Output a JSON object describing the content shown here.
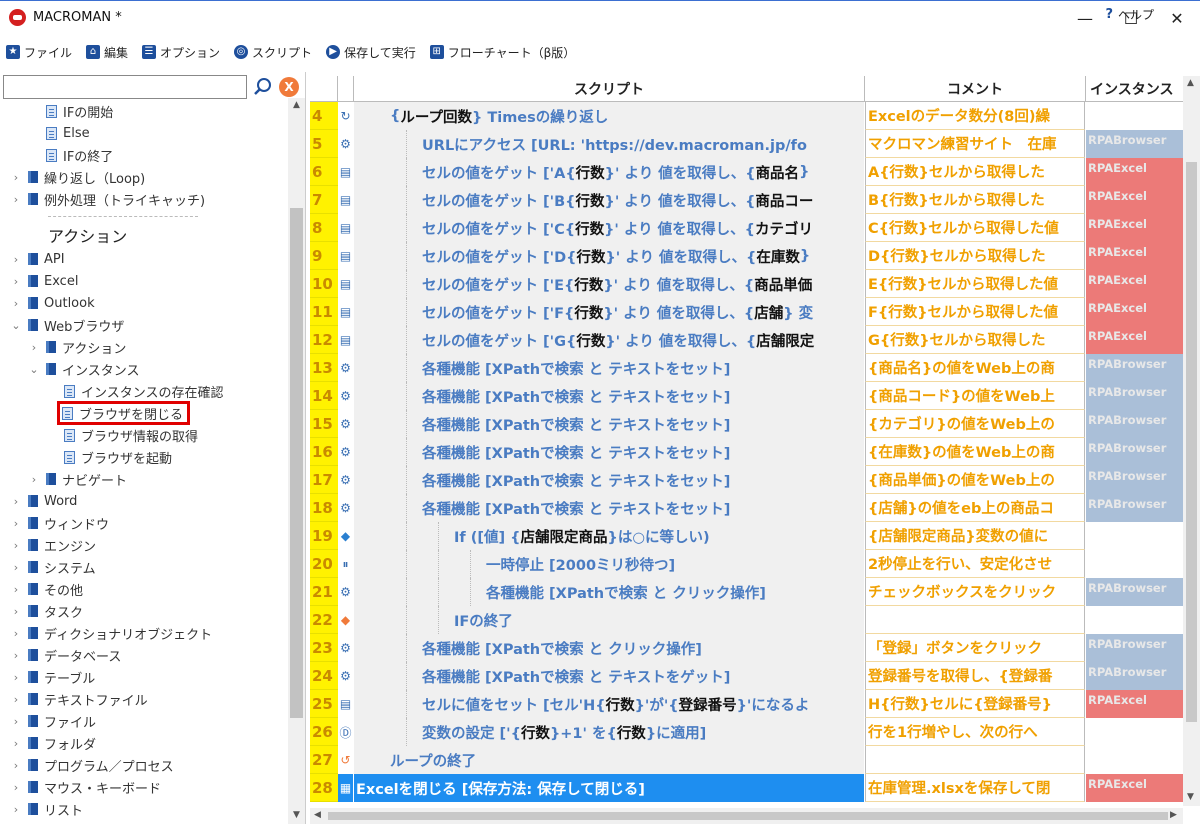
{
  "window": {
    "title": "MACROMAN *",
    "minimize": "—",
    "maximize": "☐",
    "close": "✕"
  },
  "menu": {
    "items": [
      {
        "label": "ファイル",
        "icon": "star-icon"
      },
      {
        "label": "編集",
        "icon": "home-icon"
      },
      {
        "label": "オプション",
        "icon": "list-icon"
      },
      {
        "label": "スクリプト",
        "icon": "target-icon"
      },
      {
        "label": "保存して実行",
        "icon": "play-icon"
      },
      {
        "label": "フローチャート（β版）",
        "icon": "flowchart-icon"
      }
    ],
    "help": "ヘルプ"
  },
  "search": {
    "value": "",
    "clear": "X"
  },
  "tree": {
    "items": [
      {
        "label": "IFの開始",
        "type": "doc",
        "indent": 2
      },
      {
        "label": "Else",
        "type": "doc",
        "indent": 2
      },
      {
        "label": "IFの終了",
        "type": "doc",
        "indent": 2
      },
      {
        "label": "繰り返し（Loop)",
        "type": "book",
        "indent": 0,
        "chev": "›"
      },
      {
        "label": "例外処理（トライキャッチ)",
        "type": "book",
        "indent": 0,
        "chev": "›"
      },
      {
        "label": "アクション",
        "type": "section"
      },
      {
        "label": "API",
        "type": "book",
        "indent": 0,
        "chev": "›"
      },
      {
        "label": "Excel",
        "type": "book",
        "indent": 0,
        "chev": "›"
      },
      {
        "label": "Outlook",
        "type": "book",
        "indent": 0,
        "chev": "›"
      },
      {
        "label": "Webブラウザ",
        "type": "book",
        "indent": 0,
        "chev": "⌄"
      },
      {
        "label": "アクション",
        "type": "book",
        "indent": 1,
        "chev": "›"
      },
      {
        "label": "インスタンス",
        "type": "book",
        "indent": 1,
        "chev": "⌄"
      },
      {
        "label": "インスタンスの存在確認",
        "type": "doc",
        "indent": 3
      },
      {
        "label": "ブラウザを閉じる",
        "type": "doc",
        "indent": 3,
        "highlight": true
      },
      {
        "label": "ブラウザ情報の取得",
        "type": "doc",
        "indent": 3
      },
      {
        "label": "ブラウザを起動",
        "type": "doc",
        "indent": 3
      },
      {
        "label": "ナビゲート",
        "type": "book",
        "indent": 1,
        "chev": "›"
      },
      {
        "label": "Word",
        "type": "book",
        "indent": 0,
        "chev": "›"
      },
      {
        "label": "ウィンドウ",
        "type": "book",
        "indent": 0,
        "chev": "›"
      },
      {
        "label": "エンジン",
        "type": "book",
        "indent": 0,
        "chev": "›"
      },
      {
        "label": "システム",
        "type": "book",
        "indent": 0,
        "chev": "›"
      },
      {
        "label": "その他",
        "type": "book",
        "indent": 0,
        "chev": "›"
      },
      {
        "label": "タスク",
        "type": "book",
        "indent": 0,
        "chev": "›"
      },
      {
        "label": "ディクショナリオブジェクト",
        "type": "book",
        "indent": 0,
        "chev": "›"
      },
      {
        "label": "データベース",
        "type": "book",
        "indent": 0,
        "chev": "›"
      },
      {
        "label": "テーブル",
        "type": "book",
        "indent": 0,
        "chev": "›"
      },
      {
        "label": "テキストファイル",
        "type": "book",
        "indent": 0,
        "chev": "›"
      },
      {
        "label": "ファイル",
        "type": "book",
        "indent": 0,
        "chev": "›"
      },
      {
        "label": "フォルダ",
        "type": "book",
        "indent": 0,
        "chev": "›"
      },
      {
        "label": "プログラム／プロセス",
        "type": "book",
        "indent": 0,
        "chev": "›"
      },
      {
        "label": "マウス・キーボード",
        "type": "book",
        "indent": 0,
        "chev": "›"
      },
      {
        "label": "リスト",
        "type": "book",
        "indent": 0,
        "chev": "›"
      }
    ]
  },
  "grid": {
    "headers": {
      "script": "スクリプト",
      "comment": "コメント",
      "instance": "インスタンス"
    },
    "rows": [
      {
        "num": "4",
        "icon": "loop-icon",
        "glyph": "↻",
        "level": 1,
        "parts": [
          [
            "{"
          ],
          [
            "ループ回数",
            1
          ],
          [
            "} Timesの繰り返し"
          ]
        ],
        "comment": "Excelのデータ数分(8回)繰",
        "instance": "",
        "itype": ""
      },
      {
        "num": "5",
        "icon": "browser-icon",
        "glyph": "⚙",
        "level": 2,
        "parts": [
          [
            "URLにアクセス [URL: 'https://dev.macroman.jp/fo"
          ]
        ],
        "comment": "マクロマン練習サイト　在庫",
        "instance": "RPABrowser",
        "itype": "browser"
      },
      {
        "num": "6",
        "icon": "excel-cell-icon",
        "glyph": "▤",
        "level": 2,
        "parts": [
          [
            "セルの値をゲット ['A{"
          ],
          [
            "行数",
            1
          ],
          [
            "}' より 値を取得し、{"
          ],
          [
            "商品名",
            1
          ],
          [
            "}"
          ]
        ],
        "comment": "A{行数}セルから取得した",
        "instance": "RPAExcel",
        "itype": "excel"
      },
      {
        "num": "7",
        "icon": "excel-cell-icon",
        "glyph": "▤",
        "level": 2,
        "parts": [
          [
            "セルの値をゲット ['B{"
          ],
          [
            "行数",
            1
          ],
          [
            "}' より 値を取得し、{"
          ],
          [
            "商品コー",
            1
          ]
        ],
        "comment": "B{行数}セルから取得した",
        "instance": "RPAExcel",
        "itype": "excel"
      },
      {
        "num": "8",
        "icon": "excel-cell-icon",
        "glyph": "▤",
        "level": 2,
        "parts": [
          [
            "セルの値をゲット ['C{"
          ],
          [
            "行数",
            1
          ],
          [
            "}' より 値を取得し、{"
          ],
          [
            "カテゴリ",
            1
          ]
        ],
        "comment": "C{行数}セルから取得した値",
        "instance": "RPAExcel",
        "itype": "excel"
      },
      {
        "num": "9",
        "icon": "excel-cell-icon",
        "glyph": "▤",
        "level": 2,
        "parts": [
          [
            "セルの値をゲット ['D{"
          ],
          [
            "行数",
            1
          ],
          [
            "}' より 値を取得し、{"
          ],
          [
            "在庫数",
            1
          ],
          [
            "} "
          ]
        ],
        "comment": "D{行数}セルから取得した",
        "instance": "RPAExcel",
        "itype": "excel"
      },
      {
        "num": "10",
        "icon": "excel-cell-icon",
        "glyph": "▤",
        "level": 2,
        "parts": [
          [
            "セルの値をゲット ['E{"
          ],
          [
            "行数",
            1
          ],
          [
            "}' より 値を取得し、{"
          ],
          [
            "商品単価",
            1
          ]
        ],
        "comment": "E{行数}セルから取得した値",
        "instance": "RPAExcel",
        "itype": "excel"
      },
      {
        "num": "11",
        "icon": "excel-cell-icon",
        "glyph": "▤",
        "level": 2,
        "parts": [
          [
            "セルの値をゲット ['F{"
          ],
          [
            "行数",
            1
          ],
          [
            "}' より 値を取得し、{"
          ],
          [
            "店舗",
            1
          ],
          [
            "} 変"
          ]
        ],
        "comment": "F{行数}セルから取得した値",
        "instance": "RPAExcel",
        "itype": "excel"
      },
      {
        "num": "12",
        "icon": "excel-cell-icon",
        "glyph": "▤",
        "level": 2,
        "parts": [
          [
            "セルの値をゲット ['G{"
          ],
          [
            "行数",
            1
          ],
          [
            "}' より 値を取得し、{"
          ],
          [
            "店舗限定",
            1
          ]
        ],
        "comment": "G{行数}セルから取得した",
        "instance": "RPAExcel",
        "itype": "excel"
      },
      {
        "num": "13",
        "icon": "browser-icon",
        "glyph": "⚙",
        "level": 2,
        "parts": [
          [
            "各種機能 [XPathで検索 と テキストをセット]"
          ]
        ],
        "comment": "{商品名}の値をWeb上の商",
        "instance": "RPABrowser",
        "itype": "browser"
      },
      {
        "num": "14",
        "icon": "browser-icon",
        "glyph": "⚙",
        "level": 2,
        "parts": [
          [
            "各種機能 [XPathで検索 と テキストをセット]"
          ]
        ],
        "comment": "{商品コード}の値をWeb上",
        "instance": "RPABrowser",
        "itype": "browser"
      },
      {
        "num": "15",
        "icon": "browser-icon",
        "glyph": "⚙",
        "level": 2,
        "parts": [
          [
            "各種機能 [XPathで検索 と テキストをセット]"
          ]
        ],
        "comment": "{カテゴリ}の値をWeb上の",
        "instance": "RPABrowser",
        "itype": "browser"
      },
      {
        "num": "16",
        "icon": "browser-icon",
        "glyph": "⚙",
        "level": 2,
        "parts": [
          [
            "各種機能 [XPathで検索 と テキストをセット]"
          ]
        ],
        "comment": "{在庫数}の値をWeb上の商",
        "instance": "RPABrowser",
        "itype": "browser"
      },
      {
        "num": "17",
        "icon": "browser-icon",
        "glyph": "⚙",
        "level": 2,
        "parts": [
          [
            "各種機能 [XPathで検索 と テキストをセット]"
          ]
        ],
        "comment": "{商品単価}の値をWeb上の",
        "instance": "RPABrowser",
        "itype": "browser"
      },
      {
        "num": "18",
        "icon": "browser-icon",
        "glyph": "⚙",
        "level": 2,
        "parts": [
          [
            "各種機能 [XPathで検索 と テキストをセット]"
          ]
        ],
        "comment": "{店舗}の値をeb上の商品コ",
        "instance": "RPABrowser",
        "itype": "browser"
      },
      {
        "num": "19",
        "icon": "if-diamond-icon",
        "glyph": "◆",
        "level": 3,
        "parts": [
          [
            "If ([値] {"
          ],
          [
            "店舗限定商品",
            1
          ],
          [
            "}は○に等しい)"
          ]
        ],
        "comment": "{店舗限定商品}変数の値に",
        "instance": "",
        "itype": ""
      },
      {
        "num": "20",
        "icon": "pause-icon",
        "glyph": "⏸",
        "level": 4,
        "parts": [
          [
            "一時停止 [2000ミリ秒待つ]"
          ]
        ],
        "comment": "2秒停止を行い、安定化させ",
        "instance": "",
        "itype": ""
      },
      {
        "num": "21",
        "icon": "browser-icon",
        "glyph": "⚙",
        "level": 4,
        "parts": [
          [
            "各種機能 [XPathで検索 と クリック操作]"
          ]
        ],
        "comment": "チェックボックスをクリック",
        "instance": "RPABrowser",
        "itype": "browser"
      },
      {
        "num": "22",
        "icon": "endif-diamond-icon",
        "glyph": "◆",
        "level": 3,
        "parts": [
          [
            "IFの終了"
          ]
        ],
        "comment": "",
        "instance": "",
        "itype": ""
      },
      {
        "num": "23",
        "icon": "browser-icon",
        "glyph": "⚙",
        "level": 2,
        "parts": [
          [
            "各種機能 [XPathで検索 と クリック操作]"
          ]
        ],
        "comment": "「登録」ボタンをクリック",
        "instance": "RPABrowser",
        "itype": "browser"
      },
      {
        "num": "24",
        "icon": "browser-icon",
        "glyph": "⚙",
        "level": 2,
        "parts": [
          [
            "各種機能 [XPathで検索 と テキストをゲット]"
          ]
        ],
        "comment": "登録番号を取得し、{登録番",
        "instance": "RPABrowser",
        "itype": "browser"
      },
      {
        "num": "25",
        "icon": "excel-cell-icon",
        "glyph": "▤",
        "level": 2,
        "parts": [
          [
            "セルに値をセット [セル'H{"
          ],
          [
            "行数",
            1
          ],
          [
            "}'が'{"
          ],
          [
            "登録番号",
            1
          ],
          [
            "}'になるよ"
          ]
        ],
        "comment": "H{行数}セルに{登録番号}",
        "instance": "RPAExcel",
        "itype": "excel"
      },
      {
        "num": "26",
        "icon": "variable-icon",
        "glyph": "Ⓓ",
        "level": 2,
        "parts": [
          [
            "変数の設定 ['{"
          ],
          [
            "行数",
            1
          ],
          [
            "}+1' を{"
          ],
          [
            "行数",
            1
          ],
          [
            "}に適用]"
          ]
        ],
        "comment": "行を1行増やし、次の行へ",
        "instance": "",
        "itype": ""
      },
      {
        "num": "27",
        "icon": "loop-end-icon",
        "glyph": "↺",
        "level": 1,
        "parts": [
          [
            "ループの終了"
          ]
        ],
        "comment": "",
        "instance": "",
        "itype": ""
      },
      {
        "num": "28",
        "icon": "excel-close-icon",
        "glyph": "▦",
        "level": 0,
        "parts": [
          [
            "Excelを閉じる [保存方法: 保存して閉じる]"
          ]
        ],
        "comment": "在庫管理.xlsxを保存して閉",
        "instance": "RPAExcel",
        "itype": "excel",
        "selected": true
      }
    ]
  }
}
